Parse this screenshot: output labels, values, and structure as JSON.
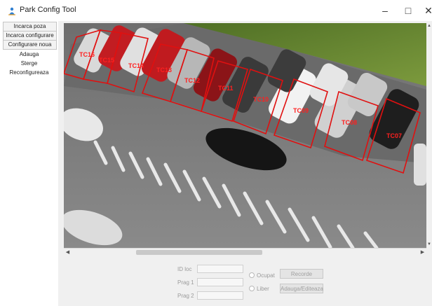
{
  "window": {
    "title": "Park Config Tool",
    "minimize_glyph": "–",
    "maximize_glyph": "□",
    "close_glyph": "✕"
  },
  "sidebar": {
    "items": [
      {
        "label": "Incarca poza",
        "style": "primary"
      },
      {
        "label": "Incarca configurare",
        "style": "primary"
      },
      {
        "label": "Configurare noua",
        "style": "primary"
      },
      {
        "label": "Adauga",
        "style": "secondary"
      },
      {
        "label": "Sterge",
        "style": "secondary"
      },
      {
        "label": "Reconfigureaza",
        "style": "secondary"
      }
    ]
  },
  "parking_spots": [
    {
      "id": "TC16"
    },
    {
      "id": "TC15"
    },
    {
      "id": "TC14"
    },
    {
      "id": "TC13"
    },
    {
      "id": "TC12"
    },
    {
      "id": "TC11"
    },
    {
      "id": "TC10"
    },
    {
      "id": "TC09"
    },
    {
      "id": "TC08"
    },
    {
      "id": "TC07"
    }
  ],
  "form": {
    "id_loc_label": "ID loc",
    "prag1_label": "Prag 1",
    "prag2_label": "Prag 2",
    "id_loc_value": "",
    "prag1_value": "",
    "prag2_value": "",
    "radio_ocupat": "Ocupat",
    "radio_liber": "Liber",
    "btn_recorde": "Recorde",
    "btn_adauga": "Adauga/Editeaza"
  },
  "colors": {
    "spot_outline": "#e01010",
    "spot_label": "#ff2020",
    "image_asphalt": "#7d7d7d",
    "grass": "#5f7f2f"
  }
}
